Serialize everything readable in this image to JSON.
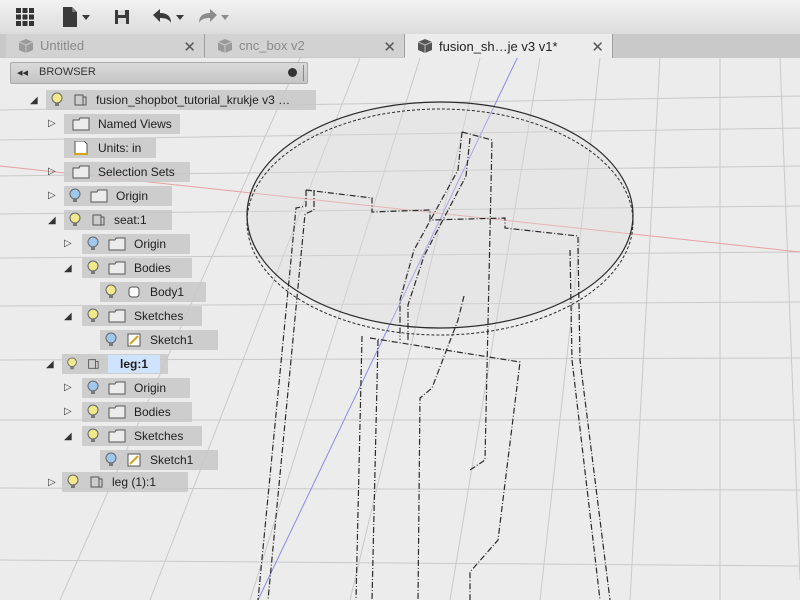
{
  "toolbar": {
    "icons": [
      "grid-icon",
      "file-icon",
      "save-icon",
      "undo-icon",
      "redo-icon"
    ]
  },
  "tabs": [
    {
      "label": "Untitled",
      "active": false
    },
    {
      "label": "cnc_box v2",
      "active": false
    },
    {
      "label": "fusion_sh…je v3 v1*",
      "active": true
    }
  ],
  "close_glyph": "✕",
  "browser": {
    "title": "BROWSER",
    "items": [
      {
        "label": "fusion_shopbot_tutorial_krukje v3 …"
      },
      {
        "label": "Named Views"
      },
      {
        "label": "Units: in"
      },
      {
        "label": "Selection Sets"
      },
      {
        "label": "Origin"
      },
      {
        "label": "seat:1"
      },
      {
        "label": "Origin"
      },
      {
        "label": "Bodies"
      },
      {
        "label": "Body1"
      },
      {
        "label": "Sketches"
      },
      {
        "label": "Sketch1"
      },
      {
        "label": "leg:1"
      },
      {
        "label": "Origin"
      },
      {
        "label": "Bodies"
      },
      {
        "label": "Sketches"
      },
      {
        "label": "Sketch1"
      },
      {
        "label": "leg (1):1"
      }
    ]
  }
}
